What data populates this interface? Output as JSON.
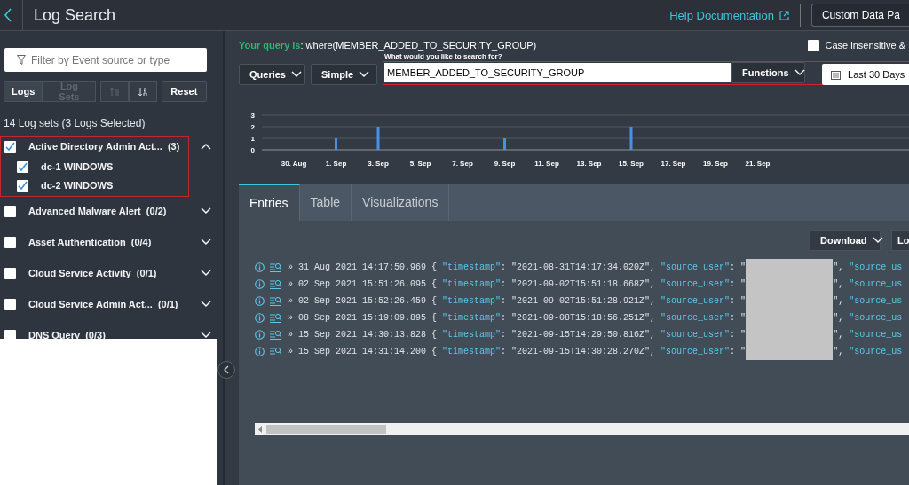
{
  "header": {
    "title": "Log Search",
    "help_link": "Help Documentation",
    "custom_button": "Custom Data Pa"
  },
  "sidebar": {
    "filter": {
      "placeholder": "Filter by Event source or type"
    },
    "view_tabs": [
      {
        "label": "Logs",
        "selected": true
      },
      {
        "label": "Log Sets",
        "selected": false
      }
    ],
    "sort_buttons": [
      {
        "kind": "asc",
        "disabled": true
      },
      {
        "kind": "desc",
        "disabled": false
      }
    ],
    "reset": "Reset",
    "summary": "14 Log sets (3 Logs Selected)",
    "log_sets": [
      {
        "name": "Active Directory Admin Act...",
        "count": "(3)",
        "checked": true,
        "expanded": true,
        "highlighted": true,
        "children": [
          {
            "name": "dc-1 WINDOWS",
            "checked": true
          },
          {
            "name": "dc-2 WINDOWS",
            "checked": true
          }
        ]
      },
      {
        "name": "Advanced Malware Alert",
        "count": "(0/2)",
        "checked": false,
        "expanded": false,
        "highlighted": false
      },
      {
        "name": "Asset Authentication",
        "count": "(0/4)",
        "checked": false,
        "expanded": false,
        "highlighted": false
      },
      {
        "name": "Cloud Service Activity",
        "count": "(0/1)",
        "checked": false,
        "expanded": false,
        "highlighted": false
      },
      {
        "name": "Cloud Service Admin Act...",
        "count": "(0/1)",
        "checked": false,
        "expanded": false,
        "highlighted": false
      },
      {
        "name": "DNS Query",
        "count": "(0/3)",
        "checked": false,
        "expanded": false,
        "highlighted": false
      }
    ]
  },
  "query": {
    "prefix": "Your query is",
    "text": ": where(MEMBER_ADDED_TO_SECURITY_GROUP)",
    "case_insensitive": {
      "label": "Case insensitive &",
      "checked": false
    },
    "queries_button": "Queries",
    "mode": "Simple",
    "search_label": "What would you like to search for?",
    "search_value": "MEMBER_ADDED_TO_SECURITY_GROUP",
    "functions_button": "Functions",
    "range_button": "Last 30 Days"
  },
  "chart_data": {
    "type": "bar",
    "categories": [
      "30. Aug",
      "1. Sep",
      "3. Sep",
      "5. Sep",
      "7. Sep",
      "9. Sep",
      "11. Sep",
      "13. Sep",
      "15. Sep",
      "17. Sep",
      "19. Sep",
      "21. Sep"
    ],
    "values": [
      0,
      1,
      2,
      0,
      0,
      1,
      0,
      0,
      2,
      0,
      0,
      0
    ],
    "ylim": [
      0,
      3
    ],
    "yticks": [
      0,
      1,
      2,
      3
    ]
  },
  "results": {
    "tabs": [
      {
        "label": "Entries",
        "selected": true
      },
      {
        "label": "Table",
        "selected": false
      },
      {
        "label": "Visualizations",
        "selected": false
      }
    ],
    "download_button": "Download",
    "other_button": "Lo",
    "entries": [
      {
        "arrow": "»",
        "time": "31 Aug 2021 14:17:50.969",
        "parts": [
          {
            "kind": "punct",
            "text": "{ "
          },
          {
            "kind": "key",
            "text": "\"timestamp\""
          },
          {
            "kind": "punct",
            "text": ": \"2021-08-31T14:17:34.020Z\", "
          },
          {
            "kind": "key",
            "text": "\"source_user\""
          },
          {
            "kind": "punct",
            "text": ": \""
          },
          {
            "kind": "redacted"
          },
          {
            "kind": "punct",
            "text": "\", "
          },
          {
            "kind": "key",
            "text": "\"source_us"
          }
        ]
      },
      {
        "arrow": "»",
        "time": "02 Sep 2021 15:51:26.095",
        "parts": [
          {
            "kind": "punct",
            "text": "{ "
          },
          {
            "kind": "key",
            "text": "\"timestamp\""
          },
          {
            "kind": "punct",
            "text": ": \"2021-09-02T15:51:18.668Z\", "
          },
          {
            "kind": "key",
            "text": "\"source_user\""
          },
          {
            "kind": "punct",
            "text": ": \""
          },
          {
            "kind": "redacted"
          },
          {
            "kind": "punct",
            "text": "\", "
          },
          {
            "kind": "key",
            "text": "\"source_us"
          }
        ]
      },
      {
        "arrow": "»",
        "time": "02 Sep 2021 15:52:26.459",
        "parts": [
          {
            "kind": "punct",
            "text": "{ "
          },
          {
            "kind": "key",
            "text": "\"timestamp\""
          },
          {
            "kind": "punct",
            "text": ": \"2021-09-02T15:51:28.921Z\", "
          },
          {
            "kind": "key",
            "text": "\"source_user\""
          },
          {
            "kind": "punct",
            "text": ": \""
          },
          {
            "kind": "redacted"
          },
          {
            "kind": "punct",
            "text": "\", "
          },
          {
            "kind": "key",
            "text": "\"source_us"
          }
        ]
      },
      {
        "arrow": "»",
        "time": "08 Sep 2021 15:19:09.895",
        "parts": [
          {
            "kind": "punct",
            "text": "{ "
          },
          {
            "kind": "key",
            "text": "\"timestamp\""
          },
          {
            "kind": "punct",
            "text": ": \"2021-09-08T15:18:56.251Z\", "
          },
          {
            "kind": "key",
            "text": "\"source_user\""
          },
          {
            "kind": "punct",
            "text": ": \""
          },
          {
            "kind": "redacted"
          },
          {
            "kind": "punct",
            "text": "\", "
          },
          {
            "kind": "key",
            "text": "\"source_us"
          }
        ]
      },
      {
        "arrow": "»",
        "time": "15 Sep 2021 14:30:13.828",
        "parts": [
          {
            "kind": "punct",
            "text": "{ "
          },
          {
            "kind": "key",
            "text": "\"timestamp\""
          },
          {
            "kind": "punct",
            "text": ": \"2021-09-15T14:29:50.816Z\", "
          },
          {
            "kind": "key",
            "text": "\"source_user\""
          },
          {
            "kind": "punct",
            "text": ": \""
          },
          {
            "kind": "redacted"
          },
          {
            "kind": "punct",
            "text": "\", "
          },
          {
            "kind": "key",
            "text": "\"source_us"
          }
        ]
      },
      {
        "arrow": "»",
        "time": "15 Sep 2021 14:31:14.200",
        "parts": [
          {
            "kind": "punct",
            "text": "{ "
          },
          {
            "kind": "key",
            "text": "\"timestamp\""
          },
          {
            "kind": "punct",
            "text": ": \"2021-09-15T14:30:28.270Z\", "
          },
          {
            "kind": "key",
            "text": "\"source_user\""
          },
          {
            "kind": "punct",
            "text": ": \""
          },
          {
            "kind": "redacted"
          },
          {
            "kind": "punct",
            "text": "\", "
          },
          {
            "kind": "key",
            "text": "\"source_us"
          }
        ]
      }
    ]
  }
}
